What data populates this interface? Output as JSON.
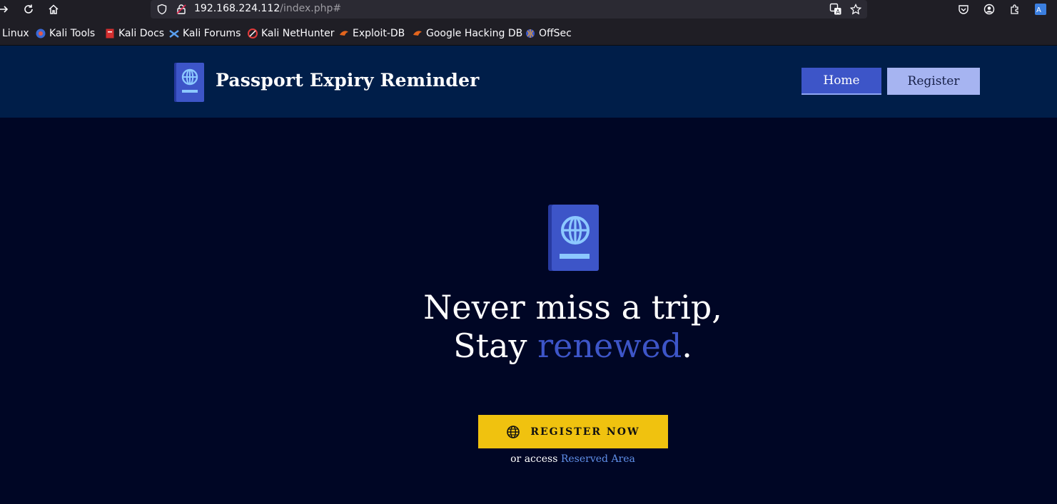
{
  "browser": {
    "url_host": "192.168.224.112",
    "url_path": "/index.php#",
    "bookmarks": [
      {
        "label": "Linux",
        "icon": "none"
      },
      {
        "label": "Kali Tools",
        "icon": "kali-tools-icon"
      },
      {
        "label": "Kali Docs",
        "icon": "kali-docs-icon"
      },
      {
        "label": "Kali Forums",
        "icon": "kali-forums-icon"
      },
      {
        "label": "Kali NetHunter",
        "icon": "kali-nethunter-icon"
      },
      {
        "label": "Exploit-DB",
        "icon": "exploit-db-icon"
      },
      {
        "label": "Google Hacking DB",
        "icon": "ghdb-icon"
      },
      {
        "label": "OffSec",
        "icon": "offsec-icon"
      }
    ]
  },
  "header": {
    "brand": "Passport Expiry Reminder",
    "nav": {
      "home": "Home",
      "register": "Register"
    }
  },
  "hero": {
    "line1": "Never miss a trip,",
    "line2_prefix": "Stay ",
    "line2_accent": "renewed",
    "line2_suffix": ".",
    "cta": "REGISTER NOW",
    "access_prefix": "or access ",
    "access_link": "Reserved Area"
  },
  "colors": {
    "header_bg": "#001e49",
    "page_bg": "#000625",
    "accent": "#3d55c8",
    "cta": "#f0c20f"
  }
}
